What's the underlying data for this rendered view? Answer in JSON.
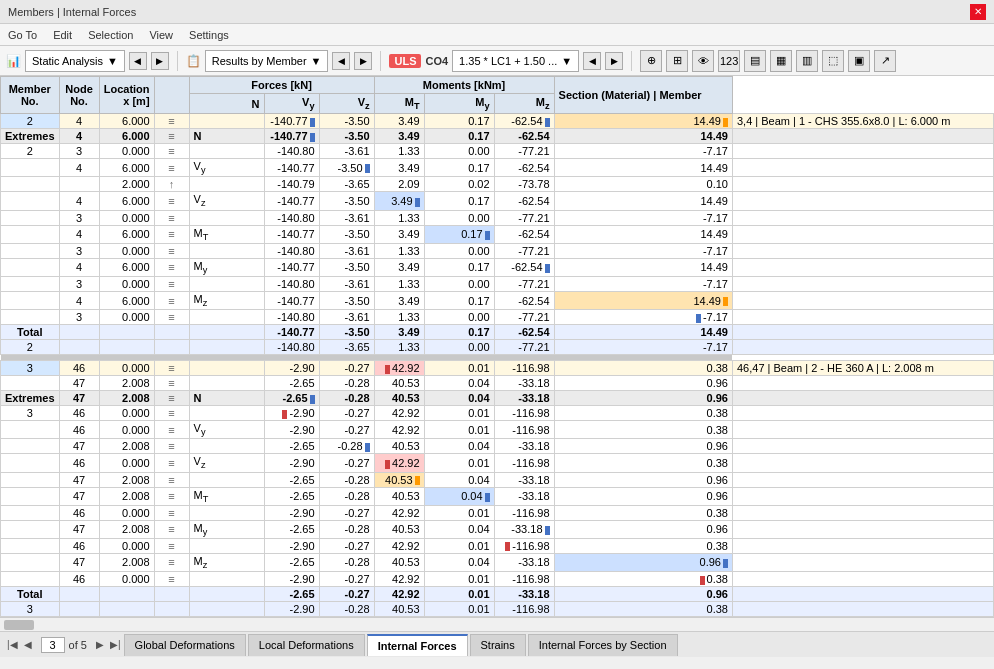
{
  "titleBar": {
    "text": "Members | Internal Forces",
    "closeBtn": "✕"
  },
  "menuBar": {
    "items": [
      "Go To",
      "Edit",
      "Selection",
      "View",
      "Settings"
    ]
  },
  "toolbar": {
    "analysisLabel": "Static Analysis",
    "resultsLabel": "Results by Member",
    "ulsLabel": "ULS",
    "co4Label": "CO4",
    "comboLabel": "1.35 * LC1 + 1.50 ...",
    "iconBtns": [
      "⊕",
      "⊞",
      "▣",
      "✕✕✕",
      "▤",
      "▦",
      "▥",
      "⬚",
      "▣",
      "↗"
    ]
  },
  "tableHeaders": {
    "memberNo": "Member\nNo.",
    "nodeNo": "Node\nNo.",
    "locationLabel": "Location\nx [m]",
    "forcesGroup": "Forces [kN]",
    "momentsGroup": "Moments [kNm]",
    "n": "N",
    "vy": "Vy",
    "vz": "Vz",
    "mt": "MT",
    "my": "My",
    "mz": "Mz",
    "section": "Section (Material) | Member"
  },
  "rows": [
    {
      "type": "member",
      "memberNo": "2",
      "nodeNo": "4",
      "location": "6.000",
      "eq": "≡",
      "label": "",
      "n": "-140.77",
      "vy": "-3.50",
      "vz": "3.49",
      "mt": "0.17",
      "my": "-62.54",
      "mz": "14.49",
      "section": "3,4 | Beam | 1 - CHS 355.6x8.0 | L: 6.000 m",
      "nBar": "blue",
      "myBar": "blue",
      "mzBar": "orange"
    },
    {
      "type": "extremes",
      "memberNo": "Extremes",
      "nodeNo": "4",
      "location": "6.000",
      "eq": "≡",
      "label": "N",
      "n": "-140.77",
      "vy": "-3.50",
      "vz": "3.49",
      "mt": "0.17",
      "my": "-62.54",
      "mz": "14.49",
      "section": "",
      "nBar": "blue"
    },
    {
      "type": "sub",
      "memberNo": "2",
      "nodeNo": "3",
      "location": "0.000",
      "eq": "≡",
      "label": "",
      "n": "-140.80",
      "vy": "-3.61",
      "vz": "1.33",
      "mt": "0.00",
      "my": "-77.21",
      "mz": "-7.17",
      "section": ""
    },
    {
      "type": "sub",
      "memberNo": "",
      "nodeNo": "4",
      "location": "6.000",
      "eq": "≡",
      "label": "Vy",
      "n": "-140.77",
      "vy": "-3.50",
      "vz": "3.49",
      "mt": "0.17",
      "my": "-62.54",
      "mz": "14.49",
      "section": "",
      "vyBar": "blue"
    },
    {
      "type": "sub",
      "memberNo": "",
      "nodeNo": "",
      "location": "2.000",
      "eq": "↑",
      "label": "",
      "n": "-140.79",
      "vy": "-3.65",
      "vz": "2.09",
      "mt": "0.02",
      "my": "-73.78",
      "mz": "0.10",
      "section": ""
    },
    {
      "type": "sub",
      "memberNo": "",
      "nodeNo": "4",
      "location": "6.000",
      "eq": "≡",
      "label": "Vz",
      "n": "-140.77",
      "vy": "-3.50",
      "vz": "3.49",
      "mt": "0.17",
      "my": "-62.54",
      "mz": "14.49",
      "section": "",
      "vzBar": "blue"
    },
    {
      "type": "sub",
      "memberNo": "",
      "nodeNo": "3",
      "location": "0.000",
      "eq": "≡",
      "label": "",
      "n": "-140.80",
      "vy": "-3.61",
      "vz": "1.33",
      "mt": "0.00",
      "my": "-77.21",
      "mz": "-7.17",
      "section": ""
    },
    {
      "type": "sub",
      "memberNo": "",
      "nodeNo": "4",
      "location": "6.000",
      "eq": "≡",
      "label": "MT",
      "n": "-140.77",
      "vy": "-3.50",
      "vz": "3.49",
      "mt": "0.17",
      "my": "-62.54",
      "mz": "14.49",
      "section": "",
      "mtBar": "blue"
    },
    {
      "type": "sub",
      "memberNo": "",
      "nodeNo": "3",
      "location": "0.000",
      "eq": "≡",
      "label": "",
      "n": "-140.80",
      "vy": "-3.61",
      "vz": "1.33",
      "mt": "0.00",
      "my": "-77.21",
      "mz": "-7.17",
      "section": ""
    },
    {
      "type": "sub",
      "memberNo": "",
      "nodeNo": "4",
      "location": "6.000",
      "eq": "≡",
      "label": "My",
      "n": "-140.77",
      "vy": "-3.50",
      "vz": "3.49",
      "mt": "0.17",
      "my": "-62.54",
      "mz": "14.49",
      "section": "",
      "myBar": "blue"
    },
    {
      "type": "sub",
      "memberNo": "",
      "nodeNo": "3",
      "location": "0.000",
      "eq": "≡",
      "label": "",
      "n": "-140.80",
      "vy": "-3.61",
      "vz": "1.33",
      "mt": "0.00",
      "my": "-77.21",
      "mz": "-7.17",
      "section": ""
    },
    {
      "type": "sub",
      "memberNo": "",
      "nodeNo": "4",
      "location": "6.000",
      "eq": "≡",
      "label": "Mz",
      "n": "-140.77",
      "vy": "-3.50",
      "vz": "3.49",
      "mt": "0.17",
      "my": "-62.54",
      "mz": "14.49",
      "section": "",
      "mzBar": "orange"
    },
    {
      "type": "sub",
      "memberNo": "",
      "nodeNo": "3",
      "location": "0.000",
      "eq": "≡",
      "label": "",
      "n": "-140.80",
      "vy": "-3.61",
      "vz": "1.33",
      "mt": "0.00",
      "my": "-77.21",
      "mz": "-7.17",
      "section": "",
      "mzBar2": "blue"
    },
    {
      "type": "total",
      "memberNo": "Total",
      "nodeNo": "",
      "location": "",
      "eq": "",
      "label": "",
      "n": "-140.77",
      "vy": "-3.50",
      "vz": "3.49",
      "mt": "0.17",
      "my": "-62.54",
      "mz": "14.49",
      "section": ""
    },
    {
      "type": "total2",
      "memberNo": "2",
      "nodeNo": "",
      "location": "",
      "eq": "",
      "label": "",
      "n": "-140.80",
      "vy": "-3.65",
      "vz": "1.33",
      "mt": "0.00",
      "my": "-77.21",
      "mz": "-7.17",
      "section": ""
    },
    {
      "type": "separator"
    },
    {
      "type": "member",
      "memberNo": "3",
      "nodeNo": "46",
      "location": "0.000",
      "eq": "≡",
      "label": "",
      "n": "-2.90",
      "vy": "-0.27",
      "vz": "42.92",
      "mt": "0.01",
      "my": "-116.98",
      "mz": "0.38",
      "section": "46,47 | Beam | 2 - HE 360 A | L: 2.008 m",
      "vzBar": "red"
    },
    {
      "type": "sub",
      "memberNo": "",
      "nodeNo": "47",
      "location": "2.008",
      "eq": "≡",
      "label": "",
      "n": "-2.65",
      "vy": "-0.28",
      "vz": "40.53",
      "mt": "0.04",
      "my": "-33.18",
      "mz": "0.96",
      "section": ""
    },
    {
      "type": "extremes",
      "memberNo": "Extremes",
      "nodeNo": "47",
      "location": "2.008",
      "eq": "≡",
      "label": "N",
      "n": "-2.65",
      "vy": "-0.28",
      "vz": "40.53",
      "mt": "0.04",
      "my": "-33.18",
      "mz": "0.96",
      "section": "",
      "nBar": "blue"
    },
    {
      "type": "sub2",
      "memberNo": "3",
      "nodeNo": "46",
      "location": "0.000",
      "eq": "≡",
      "label": "",
      "n": "-2.90",
      "vy": "-0.27",
      "vz": "42.92",
      "mt": "0.01",
      "my": "-116.98",
      "mz": "0.38",
      "section": "",
      "nBar2": "red"
    },
    {
      "type": "sub2",
      "memberNo": "",
      "nodeNo": "46",
      "location": "0.000",
      "eq": "≡",
      "label": "Vy",
      "n": "-2.90",
      "vy": "-0.27",
      "vz": "42.92",
      "mt": "0.01",
      "my": "-116.98",
      "mz": "0.38",
      "section": ""
    },
    {
      "type": "sub2",
      "memberNo": "",
      "nodeNo": "47",
      "location": "2.008",
      "eq": "≡",
      "label": "",
      "n": "-2.65",
      "vy": "-0.28",
      "vz": "40.53",
      "mt": "0.04",
      "my": "-33.18",
      "mz": "0.96",
      "section": "",
      "vyBar": "blue"
    },
    {
      "type": "sub2",
      "memberNo": "",
      "nodeNo": "46",
      "location": "0.000",
      "eq": "≡",
      "label": "Vz",
      "n": "-2.90",
      "vy": "-0.27",
      "vz": "42.92",
      "mt": "0.01",
      "my": "-116.98",
      "mz": "0.38",
      "section": "",
      "vzBar": "red"
    },
    {
      "type": "sub2",
      "memberNo": "",
      "nodeNo": "47",
      "location": "2.008",
      "eq": "≡",
      "label": "",
      "n": "-2.65",
      "vy": "-0.28",
      "vz": "40.53",
      "mt": "0.04",
      "my": "-33.18",
      "mz": "0.96",
      "section": "",
      "vzBar2": "orange"
    },
    {
      "type": "sub2",
      "memberNo": "",
      "nodeNo": "47",
      "location": "2.008",
      "eq": "≡",
      "label": "MT",
      "n": "-2.65",
      "vy": "-0.28",
      "vz": "40.53",
      "mt": "0.04",
      "my": "-33.18",
      "mz": "0.96",
      "section": "",
      "mtBar": "blue"
    },
    {
      "type": "sub2",
      "memberNo": "",
      "nodeNo": "46",
      "location": "0.000",
      "eq": "≡",
      "label": "",
      "n": "-2.90",
      "vy": "-0.27",
      "vz": "42.92",
      "mt": "0.01",
      "my": "-116.98",
      "mz": "0.38",
      "section": "",
      "mtBar2": "red"
    },
    {
      "type": "sub2",
      "memberNo": "",
      "nodeNo": "47",
      "location": "2.008",
      "eq": "≡",
      "label": "My",
      "n": "-2.65",
      "vy": "-0.28",
      "vz": "40.53",
      "mt": "0.04",
      "my": "-33.18",
      "mz": "0.96",
      "section": "",
      "myBar": "blue"
    },
    {
      "type": "sub2",
      "memberNo": "",
      "nodeNo": "46",
      "location": "0.000",
      "eq": "≡",
      "label": "",
      "n": "-2.90",
      "vy": "-0.27",
      "vz": "42.92",
      "mt": "0.01",
      "my": "-116.98",
      "mz": "0.38",
      "section": "",
      "myBar2": "red"
    },
    {
      "type": "sub2",
      "memberNo": "",
      "nodeNo": "47",
      "location": "2.008",
      "eq": "≡",
      "label": "Mz",
      "n": "-2.65",
      "vy": "-0.28",
      "vz": "40.53",
      "mt": "0.04",
      "my": "-33.18",
      "mz": "0.96",
      "section": "",
      "mzBar": "blue"
    },
    {
      "type": "sub2",
      "memberNo": "",
      "nodeNo": "46",
      "location": "0.000",
      "eq": "≡",
      "label": "",
      "n": "-2.90",
      "vy": "-0.27",
      "vz": "42.92",
      "mt": "0.01",
      "my": "-116.98",
      "mz": "0.38",
      "section": "",
      "mzBar2": "red"
    },
    {
      "type": "total",
      "memberNo": "Total",
      "nodeNo": "",
      "location": "",
      "eq": "",
      "label": "",
      "n": "-2.65",
      "vy": "-0.27",
      "vz": "42.92",
      "mt": "0.01",
      "my": "-33.18",
      "mz": "0.96",
      "section": ""
    },
    {
      "type": "total2",
      "memberNo": "3",
      "nodeNo": "",
      "location": "",
      "eq": "",
      "label": "",
      "n": "-2.90",
      "vy": "-0.28",
      "vz": "40.53",
      "mt": "0.01",
      "my": "-116.98",
      "mz": "0.38",
      "section": ""
    }
  ],
  "bottomTabs": {
    "pageInfo": "3",
    "ofPages": "of 5",
    "tabs": [
      "Global Deformations",
      "Local Deformations",
      "Internal Forces",
      "Strains",
      "Internal Forces by Section"
    ]
  }
}
